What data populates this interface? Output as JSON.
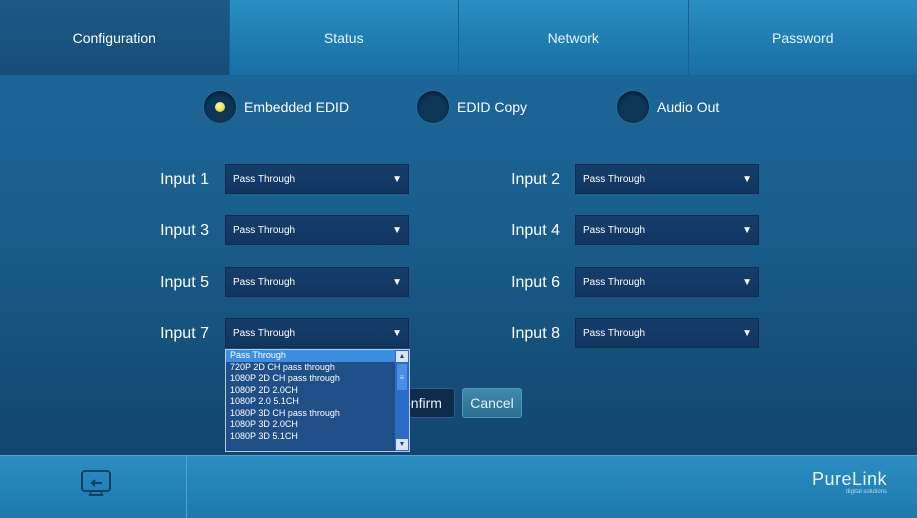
{
  "tabs": [
    {
      "label": "Configuration",
      "active": true
    },
    {
      "label": "Status",
      "active": false
    },
    {
      "label": "Network",
      "active": false
    },
    {
      "label": "Password",
      "active": false
    }
  ],
  "modes": [
    {
      "label": "Embedded EDID",
      "selected": true
    },
    {
      "label": "EDID Copy",
      "selected": false
    },
    {
      "label": "Audio Out",
      "selected": false
    }
  ],
  "inputs": [
    {
      "label": "Input 1",
      "value": "Pass Through"
    },
    {
      "label": "Input 2",
      "value": "Pass Through"
    },
    {
      "label": "Input 3",
      "value": "Pass Through"
    },
    {
      "label": "Input 4",
      "value": "Pass Through"
    },
    {
      "label": "Input 5",
      "value": "Pass Through"
    },
    {
      "label": "Input 6",
      "value": "Pass Through"
    },
    {
      "label": "Input 7",
      "value": "Pass Through"
    },
    {
      "label": "Input 8",
      "value": "Pass Through"
    }
  ],
  "dropdown": {
    "options": [
      "Pass Through",
      "720P 2D CH pass through",
      "1080P 2D CH pass through",
      "1080P 2D 2.0CH",
      "1080P 2.0 5.1CH",
      "1080P 3D CH pass through",
      "1080P 3D 2.0CH",
      "1080P 3D 5.1CH"
    ],
    "selected_index": 0
  },
  "buttons": {
    "confirm": "onfirm",
    "cancel": "Cancel"
  },
  "brand": {
    "name": "PureLink",
    "tagline": "digital solutions"
  },
  "icons": {
    "selected_dot": "#e8e04a",
    "screen": "screen-return-icon"
  }
}
